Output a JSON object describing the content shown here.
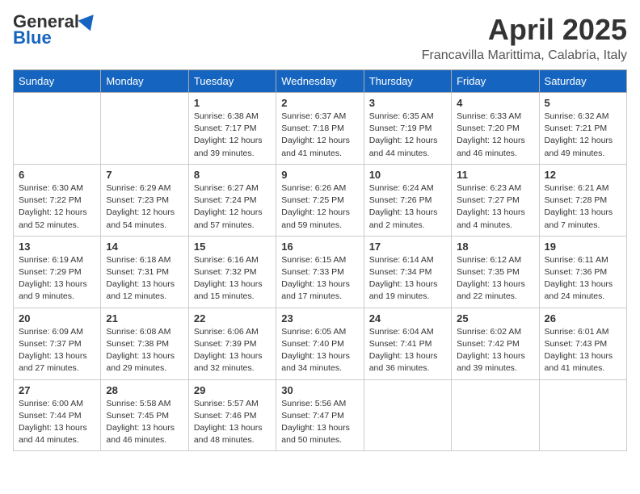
{
  "header": {
    "logo_general": "General",
    "logo_blue": "Blue",
    "month_title": "April 2025",
    "location": "Francavilla Marittima, Calabria, Italy"
  },
  "days_of_week": [
    "Sunday",
    "Monday",
    "Tuesday",
    "Wednesday",
    "Thursday",
    "Friday",
    "Saturday"
  ],
  "weeks": [
    [
      {
        "day": "",
        "detail": ""
      },
      {
        "day": "",
        "detail": ""
      },
      {
        "day": "1",
        "detail": "Sunrise: 6:38 AM\nSunset: 7:17 PM\nDaylight: 12 hours and 39 minutes."
      },
      {
        "day": "2",
        "detail": "Sunrise: 6:37 AM\nSunset: 7:18 PM\nDaylight: 12 hours and 41 minutes."
      },
      {
        "day": "3",
        "detail": "Sunrise: 6:35 AM\nSunset: 7:19 PM\nDaylight: 12 hours and 44 minutes."
      },
      {
        "day": "4",
        "detail": "Sunrise: 6:33 AM\nSunset: 7:20 PM\nDaylight: 12 hours and 46 minutes."
      },
      {
        "day": "5",
        "detail": "Sunrise: 6:32 AM\nSunset: 7:21 PM\nDaylight: 12 hours and 49 minutes."
      }
    ],
    [
      {
        "day": "6",
        "detail": "Sunrise: 6:30 AM\nSunset: 7:22 PM\nDaylight: 12 hours and 52 minutes."
      },
      {
        "day": "7",
        "detail": "Sunrise: 6:29 AM\nSunset: 7:23 PM\nDaylight: 12 hours and 54 minutes."
      },
      {
        "day": "8",
        "detail": "Sunrise: 6:27 AM\nSunset: 7:24 PM\nDaylight: 12 hours and 57 minutes."
      },
      {
        "day": "9",
        "detail": "Sunrise: 6:26 AM\nSunset: 7:25 PM\nDaylight: 12 hours and 59 minutes."
      },
      {
        "day": "10",
        "detail": "Sunrise: 6:24 AM\nSunset: 7:26 PM\nDaylight: 13 hours and 2 minutes."
      },
      {
        "day": "11",
        "detail": "Sunrise: 6:23 AM\nSunset: 7:27 PM\nDaylight: 13 hours and 4 minutes."
      },
      {
        "day": "12",
        "detail": "Sunrise: 6:21 AM\nSunset: 7:28 PM\nDaylight: 13 hours and 7 minutes."
      }
    ],
    [
      {
        "day": "13",
        "detail": "Sunrise: 6:19 AM\nSunset: 7:29 PM\nDaylight: 13 hours and 9 minutes."
      },
      {
        "day": "14",
        "detail": "Sunrise: 6:18 AM\nSunset: 7:31 PM\nDaylight: 13 hours and 12 minutes."
      },
      {
        "day": "15",
        "detail": "Sunrise: 6:16 AM\nSunset: 7:32 PM\nDaylight: 13 hours and 15 minutes."
      },
      {
        "day": "16",
        "detail": "Sunrise: 6:15 AM\nSunset: 7:33 PM\nDaylight: 13 hours and 17 minutes."
      },
      {
        "day": "17",
        "detail": "Sunrise: 6:14 AM\nSunset: 7:34 PM\nDaylight: 13 hours and 19 minutes."
      },
      {
        "day": "18",
        "detail": "Sunrise: 6:12 AM\nSunset: 7:35 PM\nDaylight: 13 hours and 22 minutes."
      },
      {
        "day": "19",
        "detail": "Sunrise: 6:11 AM\nSunset: 7:36 PM\nDaylight: 13 hours and 24 minutes."
      }
    ],
    [
      {
        "day": "20",
        "detail": "Sunrise: 6:09 AM\nSunset: 7:37 PM\nDaylight: 13 hours and 27 minutes."
      },
      {
        "day": "21",
        "detail": "Sunrise: 6:08 AM\nSunset: 7:38 PM\nDaylight: 13 hours and 29 minutes."
      },
      {
        "day": "22",
        "detail": "Sunrise: 6:06 AM\nSunset: 7:39 PM\nDaylight: 13 hours and 32 minutes."
      },
      {
        "day": "23",
        "detail": "Sunrise: 6:05 AM\nSunset: 7:40 PM\nDaylight: 13 hours and 34 minutes."
      },
      {
        "day": "24",
        "detail": "Sunrise: 6:04 AM\nSunset: 7:41 PM\nDaylight: 13 hours and 36 minutes."
      },
      {
        "day": "25",
        "detail": "Sunrise: 6:02 AM\nSunset: 7:42 PM\nDaylight: 13 hours and 39 minutes."
      },
      {
        "day": "26",
        "detail": "Sunrise: 6:01 AM\nSunset: 7:43 PM\nDaylight: 13 hours and 41 minutes."
      }
    ],
    [
      {
        "day": "27",
        "detail": "Sunrise: 6:00 AM\nSunset: 7:44 PM\nDaylight: 13 hours and 44 minutes."
      },
      {
        "day": "28",
        "detail": "Sunrise: 5:58 AM\nSunset: 7:45 PM\nDaylight: 13 hours and 46 minutes."
      },
      {
        "day": "29",
        "detail": "Sunrise: 5:57 AM\nSunset: 7:46 PM\nDaylight: 13 hours and 48 minutes."
      },
      {
        "day": "30",
        "detail": "Sunrise: 5:56 AM\nSunset: 7:47 PM\nDaylight: 13 hours and 50 minutes."
      },
      {
        "day": "",
        "detail": ""
      },
      {
        "day": "",
        "detail": ""
      },
      {
        "day": "",
        "detail": ""
      }
    ]
  ]
}
